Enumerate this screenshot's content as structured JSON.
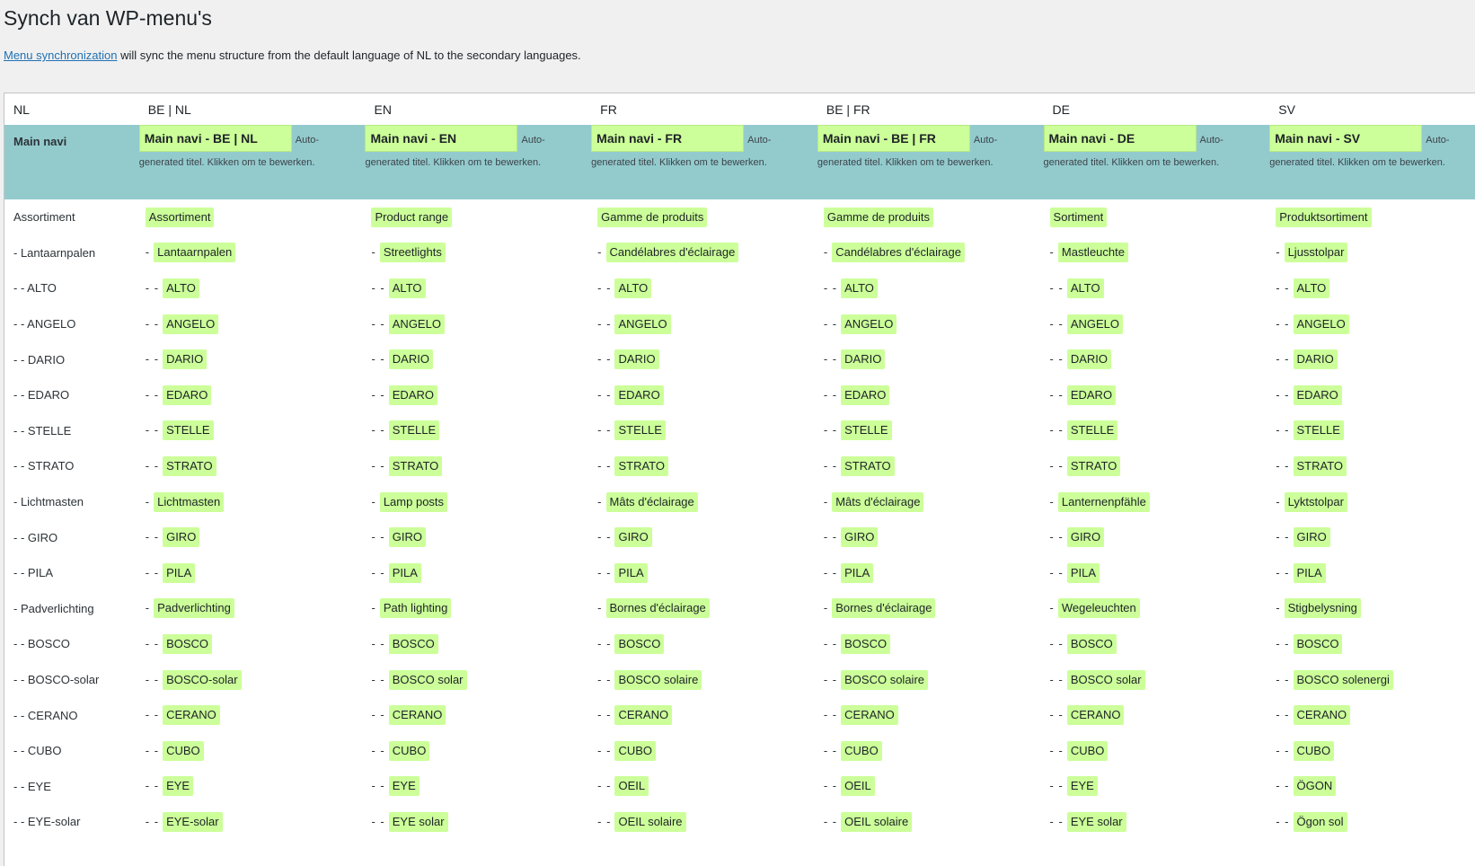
{
  "page": {
    "title": "Synch van WP-menu's",
    "intro_link": "Menu synchronization",
    "intro_text": " will sync the menu structure from the default language of NL to the secondary languages."
  },
  "headers": [
    "NL",
    "BE | NL",
    "EN",
    "FR",
    "BE | FR",
    "DE",
    "SV"
  ],
  "menu_row": {
    "label": "Main navi",
    "names": [
      "Main navi - BE | NL",
      "Main navi - EN",
      "Main navi - FR",
      "Main navi - BE | FR",
      "Main navi - DE",
      "Main navi - SV"
    ],
    "note_line1": "Auto-",
    "note_line2": "generated titel. Klikken om te bewerken."
  },
  "rows": [
    {
      "source": "Assortiment",
      "prefix": "",
      "items": [
        "Assortiment",
        "Product range",
        "Gamme de produits",
        "Gamme de produits",
        "Sortiment",
        "Produktsortiment"
      ]
    },
    {
      "source": "- Lantaarnpalen",
      "prefix": "-",
      "items": [
        "Lantaarnpalen",
        "Streetlights",
        "Candélabres d'éclairage",
        "Candélabres d'éclairage",
        "Mastleuchte",
        "Ljusstolpar"
      ]
    },
    {
      "source": "- - ALTO",
      "prefix": "- -",
      "items": [
        "ALTO",
        "ALTO",
        "ALTO",
        "ALTO",
        "ALTO",
        "ALTO"
      ]
    },
    {
      "source": "- - ANGELO",
      "prefix": "- -",
      "items": [
        "ANGELO",
        "ANGELO",
        "ANGELO",
        "ANGELO",
        "ANGELO",
        "ANGELO"
      ]
    },
    {
      "source": "- - DARIO",
      "prefix": "- -",
      "items": [
        "DARIO",
        "DARIO",
        "DARIO",
        "DARIO",
        "DARIO",
        "DARIO"
      ]
    },
    {
      "source": "- - EDARO",
      "prefix": "- -",
      "items": [
        "EDARO",
        "EDARO",
        "EDARO",
        "EDARO",
        "EDARO",
        "EDARO"
      ]
    },
    {
      "source": "- - STELLE",
      "prefix": "- -",
      "items": [
        "STELLE",
        "STELLE",
        "STELLE",
        "STELLE",
        "STELLE",
        "STELLE"
      ]
    },
    {
      "source": "- - STRATO",
      "prefix": "- -",
      "items": [
        "STRATO",
        "STRATO",
        "STRATO",
        "STRATO",
        "STRATO",
        "STRATO"
      ]
    },
    {
      "source": "- Lichtmasten",
      "prefix": "-",
      "items": [
        "Lichtmasten",
        "Lamp posts",
        "Mâts d'éclairage",
        "Mâts d'éclairage",
        "Lanternenpfähle",
        "Lyktstolpar"
      ]
    },
    {
      "source": "- - GIRO",
      "prefix": "- -",
      "items": [
        "GIRO",
        "GIRO",
        "GIRO",
        "GIRO",
        "GIRO",
        "GIRO"
      ]
    },
    {
      "source": "- - PILA",
      "prefix": "- -",
      "items": [
        "PILA",
        "PILA",
        "PILA",
        "PILA",
        "PILA",
        "PILA"
      ]
    },
    {
      "source": "- Padverlichting",
      "prefix": "-",
      "items": [
        "Padverlichting",
        "Path lighting",
        "Bornes d'éclairage",
        "Bornes d'éclairage",
        "Wegeleuchten",
        "Stigbelysning"
      ]
    },
    {
      "source": "- - BOSCO",
      "prefix": "- -",
      "items": [
        "BOSCO",
        "BOSCO",
        "BOSCO",
        "BOSCO",
        "BOSCO",
        "BOSCO"
      ]
    },
    {
      "source": "- - BOSCO-solar",
      "prefix": "- -",
      "items": [
        "BOSCO-solar",
        "BOSCO solar",
        "BOSCO solaire",
        "BOSCO solaire",
        "BOSCO solar",
        "BOSCO solenergi"
      ]
    },
    {
      "source": "- - CERANO",
      "prefix": "- -",
      "items": [
        "CERANO",
        "CERANO",
        "CERANO",
        "CERANO",
        "CERANO",
        "CERANO"
      ]
    },
    {
      "source": "- - CUBO",
      "prefix": "- -",
      "items": [
        "CUBO",
        "CUBO",
        "CUBO",
        "CUBO",
        "CUBO",
        "CUBO"
      ]
    },
    {
      "source": "- - EYE",
      "prefix": "- -",
      "items": [
        "EYE",
        "EYE",
        "OEIL",
        "OEIL",
        "EYE",
        "ÖGON"
      ]
    },
    {
      "source": "- - EYE-solar",
      "prefix": "- -",
      "items": [
        "EYE-solar",
        "EYE solar",
        "OEIL solaire",
        "OEIL solaire",
        "EYE solar",
        "Ögon sol"
      ]
    }
  ]
}
